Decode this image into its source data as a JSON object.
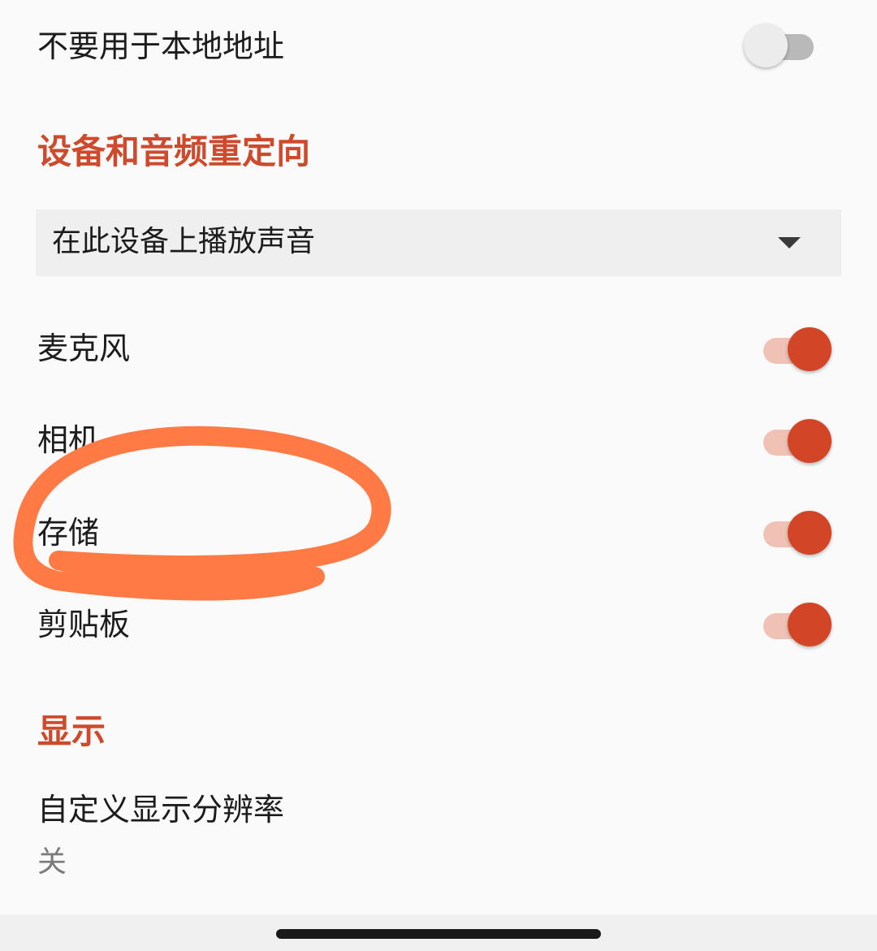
{
  "settings": {
    "local_address": {
      "label": "不要用于本地地址",
      "enabled": false
    },
    "redirect_section_title": "设备和音频重定向",
    "audio": {
      "selected": "在此设备上播放声音"
    },
    "microphone": {
      "label": "麦克风",
      "enabled": true
    },
    "camera": {
      "label": "相机",
      "enabled": true
    },
    "storage": {
      "label": "存储",
      "enabled": true
    },
    "clipboard": {
      "label": "剪贴板",
      "enabled": true
    },
    "display_section_title": "显示",
    "custom_resolution": {
      "label": "自定义显示分辨率",
      "value": "关"
    }
  },
  "colors": {
    "accent": "#cd4a2c",
    "toggle_on_thumb": "#d24527",
    "toggle_on_track": "#f0c2b6",
    "annotation_stroke": "#ff7a45"
  },
  "icons": {
    "dropdown": "caret-down-icon"
  }
}
